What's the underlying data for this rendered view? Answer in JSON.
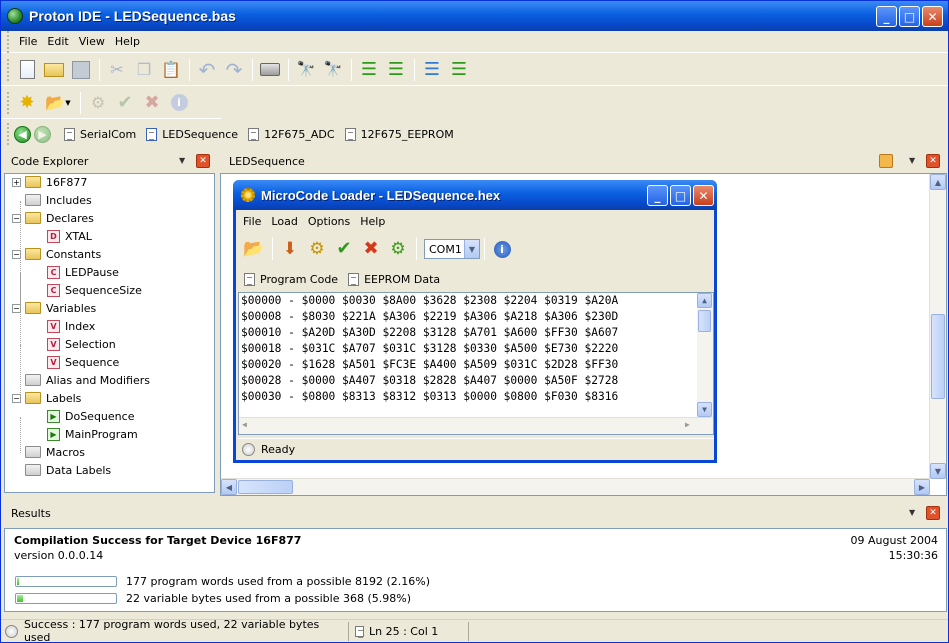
{
  "window": {
    "title": "Proton IDE - LEDSequence.bas"
  },
  "menu": [
    "File",
    "Edit",
    "View",
    "Help"
  ],
  "toolbar_main": [
    "new-file-icon",
    "open-folder-icon",
    "save-icon",
    "cut-icon",
    "copy-icon",
    "paste-icon",
    "undo-icon",
    "redo-icon",
    "print-icon",
    "find-icon",
    "find-replace-icon",
    "indent-icon",
    "outdent-icon",
    "comment-icon",
    "uncomment-icon"
  ],
  "toolbar_compile": [
    "new-project-icon",
    "open-project-icon",
    "compile-icon",
    "compile-program-icon",
    "stop-icon",
    "info-icon"
  ],
  "file_tabs": [
    "SerialCom",
    "LEDSequence",
    "12F675_ADC",
    "12F675_EEPROM"
  ],
  "code_explorer": {
    "title": "Code Explorer",
    "items": [
      {
        "label": "16F877",
        "kind": "folder",
        "expander": "+"
      },
      {
        "label": "Includes",
        "kind": "folder-gray"
      },
      {
        "label": "Declares",
        "kind": "folder",
        "expander": "-"
      },
      {
        "label": "XTAL",
        "kind": "D"
      },
      {
        "label": "Constants",
        "kind": "folder",
        "expander": "-"
      },
      {
        "label": "LEDPause",
        "kind": "C"
      },
      {
        "label": "SequenceSize",
        "kind": "C"
      },
      {
        "label": "Variables",
        "kind": "folder",
        "expander": "-"
      },
      {
        "label": "Index",
        "kind": "V"
      },
      {
        "label": "Selection",
        "kind": "V"
      },
      {
        "label": "Sequence",
        "kind": "V"
      },
      {
        "label": "Alias and Modifiers",
        "kind": "folder-gray"
      },
      {
        "label": "Labels",
        "kind": "folder",
        "expander": "-"
      },
      {
        "label": "DoSequence",
        "kind": "play"
      },
      {
        "label": "MainProgram",
        "kind": "play"
      },
      {
        "label": "Macros",
        "kind": "folder-gray"
      },
      {
        "label": "Data Labels",
        "kind": "folder-gray"
      }
    ]
  },
  "editor": {
    "title": "LEDSequence"
  },
  "loader": {
    "title": "MicroCode Loader - LEDSequence.hex",
    "menu": [
      "File",
      "Load",
      "Options",
      "Help"
    ],
    "com_port": "COM1",
    "tabs": [
      "Program Code",
      "EEPROM Data"
    ],
    "hex_rows": [
      "$00000 - $0000 $0030 $8A00 $3628 $2308 $2204 $0319 $A20A",
      "$00008 - $8030 $221A $A306 $2219 $A306 $A218 $A306 $230D",
      "$00010 - $A20D $A30D $2208 $3128 $A701 $A600 $FF30 $A607",
      "$00018 - $031C $A707 $031C $3128 $0330 $A500 $E730 $2220",
      "$00020 - $1628 $A501 $FC3E $A400 $A509 $031C $2D28 $FF30",
      "$00028 - $0000 $A407 $0318 $2828 $A407 $0000 $A50F $2728",
      "$00030 - $0800 $8313 $8312 $0313 $0000 $0800 $F030 $8316"
    ],
    "status": "Ready"
  },
  "results": {
    "title": "Results",
    "headline": "Compilation Success for Target Device 16F877",
    "version": "version 0.0.0.14",
    "date": "09 August 2004",
    "time": "15:30:36",
    "program_usage": {
      "text": "177 program words used from a possible 8192 (2.16%)",
      "percent": 2.16
    },
    "variable_usage": {
      "text": "22 variable bytes used from a possible 368 (5.98%)",
      "percent": 5.98
    }
  },
  "statusbar": {
    "message": "Success : 177 program words used, 22 variable bytes used",
    "position": "Ln 25 : Col 1"
  },
  "colors": {
    "titlebar": "#0A5FE0",
    "chrome": "#ECE9D8",
    "progress": "#3fbf2a"
  }
}
